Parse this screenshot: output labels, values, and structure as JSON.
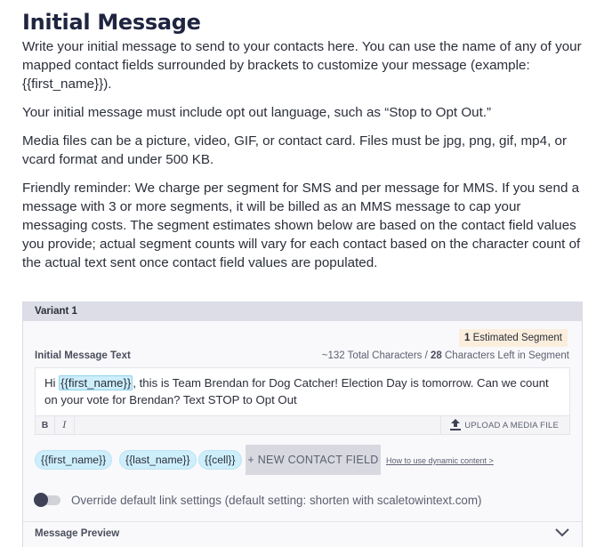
{
  "page": {
    "title": "Initial Message",
    "paragraphs": [
      "Write your initial message to send to your contacts here. You can use the name of any of your mapped contact fields surrounded by brackets to customize your message (example: {{first_name}}).",
      "Your initial message must include opt out language, such as “Stop to Opt Out.”",
      "Media files can be a picture, video, GIF, or contact card. Files must be jpg, png, gif, mp4, or vcard format and under 500 KB.",
      "Friendly reminder: We charge per segment for SMS and per message for MMS. If you send a message with 3 or more segments, it will be billed as an MMS message to cap your messaging costs. The segment estimates shown below are based on the contact field values you provide; actual segment counts will vary for each contact based on the character count of the actual text sent once contact field values are populated."
    ]
  },
  "variant": {
    "header": "Variant 1",
    "segments": {
      "count": "1",
      "label": "Estimated Segment"
    },
    "field_label": "Initial Message Text",
    "char_info": {
      "total": "~132",
      "total_label": "Total Characters /",
      "left": "28",
      "left_label": "Characters Left in Segment"
    },
    "message": {
      "prefix": "Hi ",
      "token": "{{first_name}}",
      "suffix": ", this is Team Brendan for Dog Catcher! Election Day is tomorrow. Can we count on your vote for Brendan? Text STOP to Opt Out"
    },
    "toolbar": {
      "bold": "B",
      "italic": "I",
      "upload": "UPLOAD A MEDIA FILE"
    },
    "contact_fields": [
      "{{first_name}}",
      "{{last_name}}",
      "{{cell}}"
    ],
    "new_field_button": "+ NEW CONTACT FIELD",
    "howto_link": "How to use dynamic content >",
    "override": {
      "enabled": false,
      "label": "Override default link settings (default setting: shorten with scaletowintext.com)"
    },
    "preview_label": "Message Preview"
  }
}
